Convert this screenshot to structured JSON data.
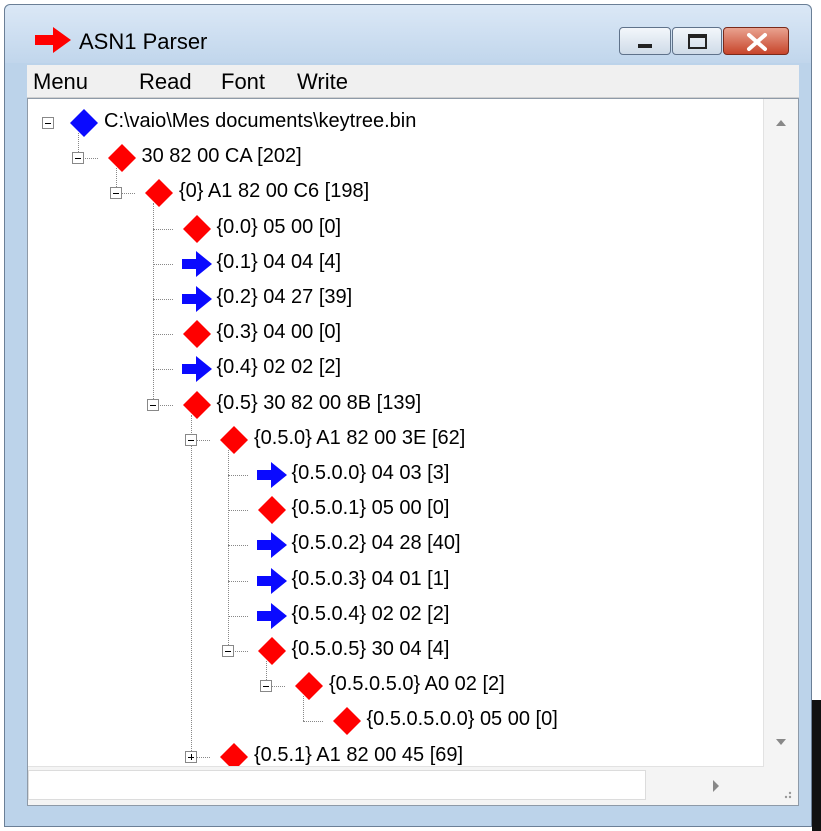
{
  "window": {
    "title": "ASN1 Parser"
  },
  "menu": {
    "items": [
      "Menu",
      "Read",
      "Font",
      "Write"
    ]
  },
  "colors": {
    "diamond": "#ff0000",
    "arrow": "#0a0aff",
    "root": "#0a0aff"
  },
  "tree": {
    "nodes": [
      {
        "label": "C:\\vaio\\Mes documents\\keytree.bin",
        "icon": "blue-diamond",
        "depth": 0,
        "toggle": "minus"
      },
      {
        "label": "30 82 00 CA [202]",
        "icon": "red-diamond",
        "depth": 1,
        "toggle": "minus"
      },
      {
        "label": "{0} A1 82 00 C6 [198]",
        "icon": "red-diamond",
        "depth": 2,
        "toggle": "minus"
      },
      {
        "label": "{0.0} 05 00 [0]",
        "icon": "red-diamond",
        "depth": 3,
        "toggle": ""
      },
      {
        "label": "{0.1} 04 04 [4]",
        "icon": "blue-arrow",
        "depth": 3,
        "toggle": ""
      },
      {
        "label": "{0.2} 04 27 [39]",
        "icon": "blue-arrow",
        "depth": 3,
        "toggle": ""
      },
      {
        "label": "{0.3} 04 00 [0]",
        "icon": "red-diamond",
        "depth": 3,
        "toggle": ""
      },
      {
        "label": "{0.4} 02 02 [2]",
        "icon": "blue-arrow",
        "depth": 3,
        "toggle": ""
      },
      {
        "label": "{0.5} 30 82 00 8B [139]",
        "icon": "red-diamond",
        "depth": 3,
        "toggle": "minus"
      },
      {
        "label": "{0.5.0} A1 82 00 3E [62]",
        "icon": "red-diamond",
        "depth": 4,
        "toggle": "minus"
      },
      {
        "label": "{0.5.0.0} 04 03 [3]",
        "icon": "blue-arrow",
        "depth": 5,
        "toggle": ""
      },
      {
        "label": "{0.5.0.1} 05 00 [0]",
        "icon": "red-diamond",
        "depth": 5,
        "toggle": ""
      },
      {
        "label": "{0.5.0.2} 04 28 [40]",
        "icon": "blue-arrow",
        "depth": 5,
        "toggle": ""
      },
      {
        "label": "{0.5.0.3} 04 01 [1]",
        "icon": "blue-arrow",
        "depth": 5,
        "toggle": ""
      },
      {
        "label": "{0.5.0.4} 02 02 [2]",
        "icon": "blue-arrow",
        "depth": 5,
        "toggle": ""
      },
      {
        "label": "{0.5.0.5} 30 04 [4]",
        "icon": "red-diamond",
        "depth": 5,
        "toggle": "minus"
      },
      {
        "label": "{0.5.0.5.0} A0 02 [2]",
        "icon": "red-diamond",
        "depth": 6,
        "toggle": "minus"
      },
      {
        "label": "{0.5.0.5.0.0} 05 00 [0]",
        "icon": "red-diamond",
        "depth": 7,
        "toggle": ""
      },
      {
        "label": "{0.5.1} A1 82 00 45 [69]",
        "icon": "red-diamond",
        "depth": 4,
        "toggle": "plus"
      }
    ]
  }
}
